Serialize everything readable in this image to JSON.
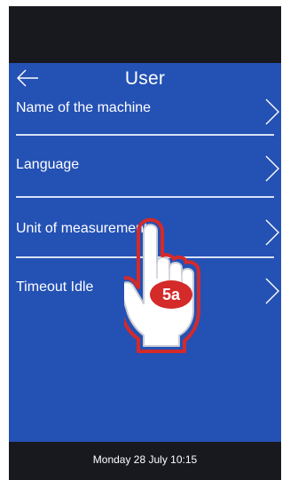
{
  "header": {
    "title": "User",
    "back_icon": "arrow-left-icon"
  },
  "menu": {
    "items": [
      {
        "label": "Name of the machine",
        "icon": "chevron-right-icon"
      },
      {
        "label": "Language",
        "icon": "chevron-right-icon"
      },
      {
        "label": "Unit of measurement",
        "icon": "chevron-right-icon"
      },
      {
        "label": "Timeout Idle",
        "icon": "chevron-right-icon"
      }
    ]
  },
  "status_bar": {
    "datetime": "Monday 28 July 10:15"
  },
  "overlay": {
    "step_label": "5a",
    "icon": "pointing-hand-icon"
  },
  "colors": {
    "screen_background": "#2451b4",
    "bars": "#17191f",
    "badge": "#d42a2a",
    "text": "#ffffff"
  }
}
